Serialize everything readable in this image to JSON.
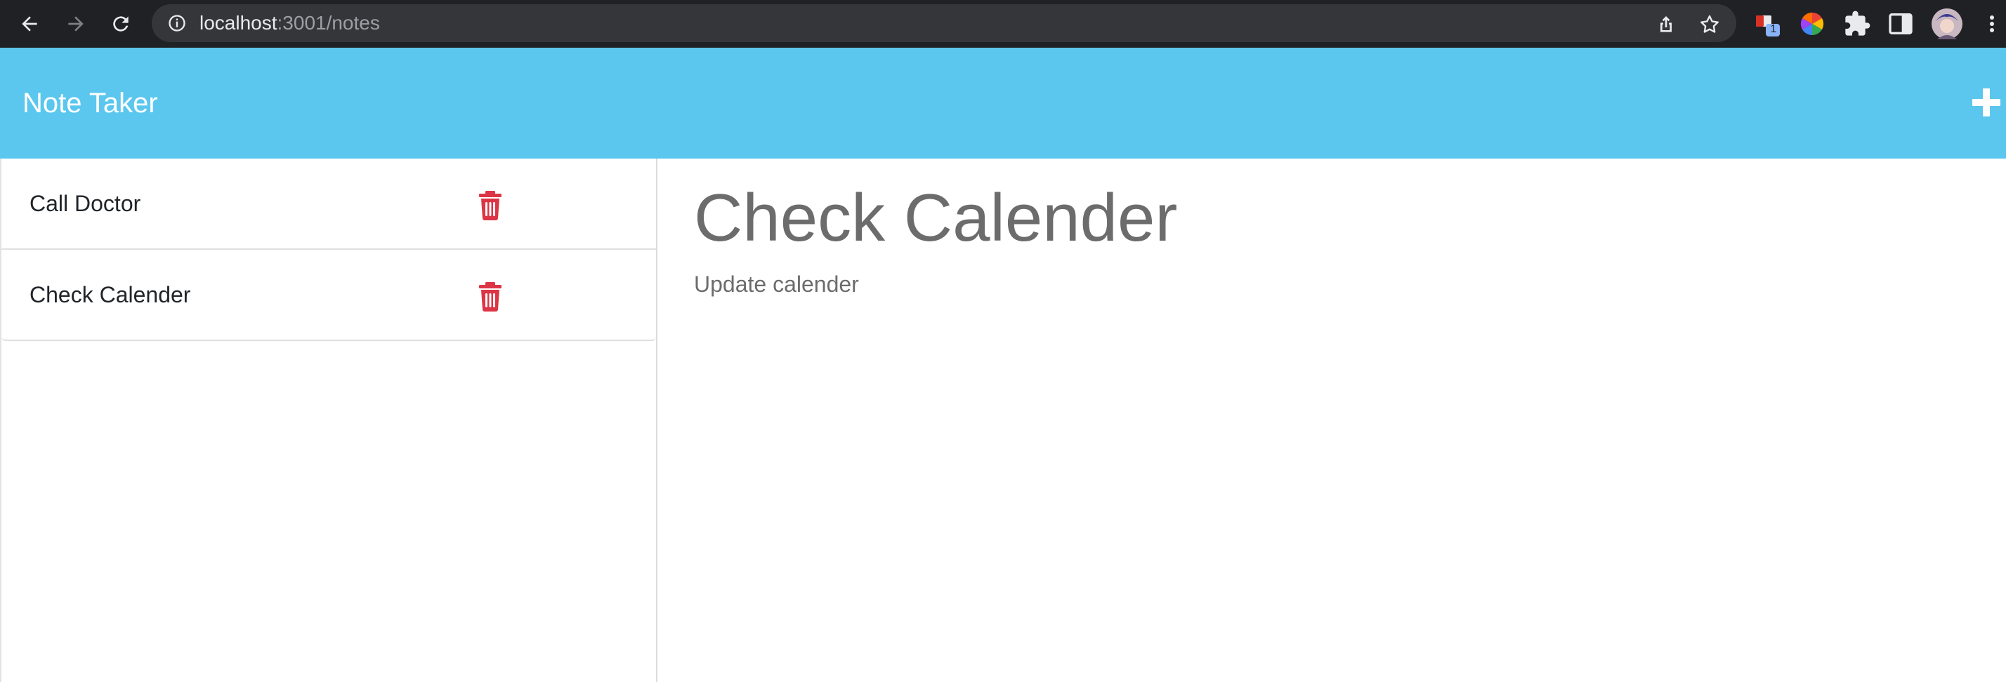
{
  "browser": {
    "url_host": "localhost",
    "url_path": ":3001/notes",
    "extension_badge": "1"
  },
  "header": {
    "title": "Note Taker"
  },
  "notes": [
    {
      "title": "Call Doctor"
    },
    {
      "title": "Check Calender"
    }
  ],
  "active_note": {
    "title": "Check Calender",
    "text": "Update calender"
  },
  "colors": {
    "header_bg": "#5bc7ee",
    "delete_icon": "#dc3545",
    "note_text": "#6c6c6c"
  }
}
